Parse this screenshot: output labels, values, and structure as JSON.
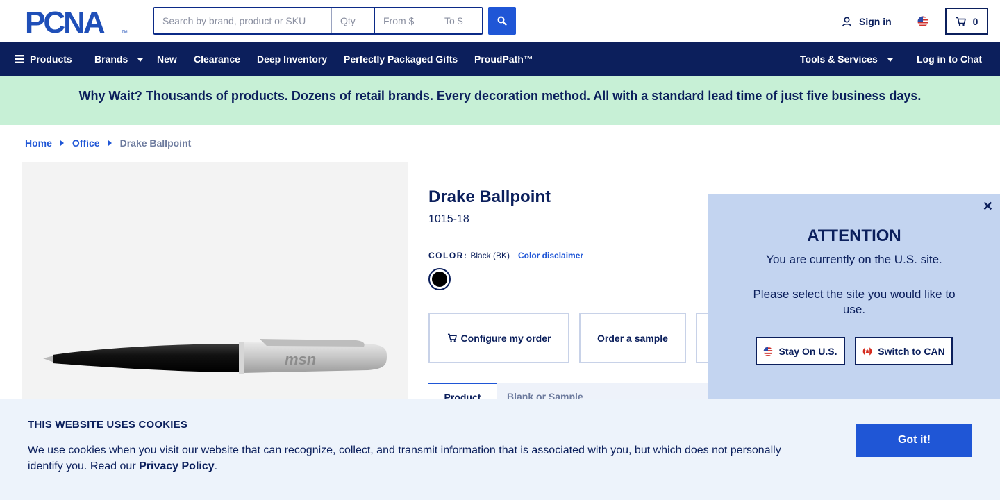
{
  "brand": {
    "logo_text": "PCNA"
  },
  "search": {
    "query_placeholder": "Search by brand, product or SKU",
    "qty_placeholder": "Qty",
    "from_placeholder": "From $",
    "to_placeholder": "To $"
  },
  "header": {
    "signin_label": "Sign in",
    "cart_count": "0"
  },
  "nav": {
    "left": [
      "Products",
      "Brands",
      "New",
      "Clearance",
      "Deep Inventory",
      "Perfectly Packaged Gifts",
      "ProudPath™"
    ],
    "tools_label": "Tools & Services",
    "chat_label": "Log in to Chat"
  },
  "promo": {
    "text": "Why Wait? Thousands of products. Dozens of retail brands. Every decoration method. All with a standard lead time of just five business days."
  },
  "breadcrumb": {
    "home": "Home",
    "category": "Office",
    "current": "Drake Ballpoint"
  },
  "product": {
    "title": "Drake Ballpoint",
    "sku": "1015-18",
    "color_label": "COLOR:",
    "color_value": "Black (BK)",
    "color_disclaimer": "Color disclaimer",
    "swatch_color": "#000000",
    "imprint_text": "msn",
    "configure_label": "Configure my order",
    "sample_label": "Order a sample",
    "tabs": [
      "Product",
      "Blank or Sample"
    ]
  },
  "attention": {
    "title": "ATTENTION",
    "message": "You are currently on the U.S. site.",
    "prompt": "Please select the site you would like to use.",
    "stay_label": "Stay On U.S.",
    "switch_label": "Switch to CAN"
  },
  "cookies": {
    "title": "THIS WEBSITE USES COOKIES",
    "text": "We use cookies when you visit our website that can recognize, collect, and transmit information that is associated with you, but which does not personally identify you. Read our",
    "link": "Privacy Policy",
    "suffix": ".",
    "button": "Got it!"
  },
  "colors": {
    "navy": "#0c1f5c",
    "accent_blue": "#1f56d6",
    "promo_green": "#c7f0d6",
    "panel_blue": "#c3d4f0"
  }
}
